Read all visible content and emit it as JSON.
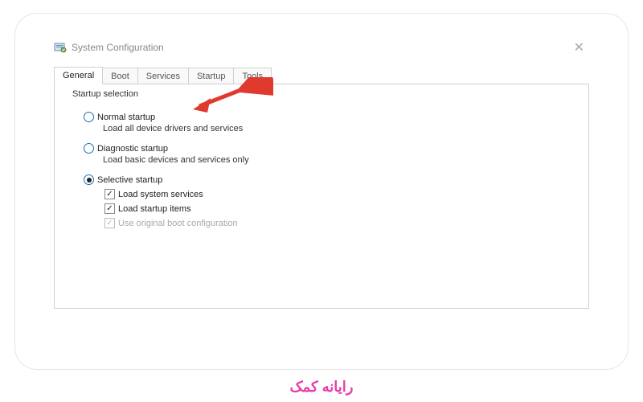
{
  "window": {
    "title": "System Configuration"
  },
  "tabs": {
    "items": [
      {
        "label": "General",
        "active": true
      },
      {
        "label": "Boot",
        "active": false
      },
      {
        "label": "Services",
        "active": false
      },
      {
        "label": "Startup",
        "active": false
      },
      {
        "label": "Tools",
        "active": false
      }
    ]
  },
  "group": {
    "label": "Startup selection",
    "normal": {
      "label": "Normal startup",
      "desc": "Load all device drivers and services",
      "checked": false
    },
    "diagnostic": {
      "label": "Diagnostic startup",
      "desc": "Load basic devices and services only",
      "checked": false
    },
    "selective": {
      "label": "Selective startup",
      "checked": true,
      "load_system": {
        "label": "Load system services",
        "checked": true
      },
      "load_startup": {
        "label": "Load startup items",
        "checked": true
      },
      "orig_boot": {
        "label": "Use original boot configuration",
        "checked": true,
        "disabled": true
      }
    }
  },
  "brand": "رایانه کمک"
}
